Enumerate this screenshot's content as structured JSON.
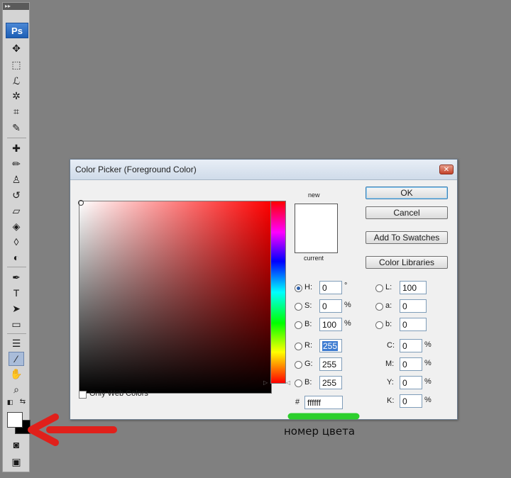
{
  "toolbar": {
    "logo": "Ps",
    "tools": [
      "move-tool",
      "marquee-tool",
      "lasso-tool",
      "magic-wand-tool",
      "crop-tool",
      "eyedropper-tool",
      "healing-brush-tool",
      "brush-tool",
      "clone-stamp-tool",
      "history-brush-tool",
      "eraser-tool",
      "paint-bucket-tool",
      "blur-tool",
      "dodge-tool",
      "pen-tool",
      "type-tool",
      "path-selection-tool",
      "shape-tool",
      "notes-tool",
      "eyedropper-active-tool",
      "hand-tool",
      "zoom-tool"
    ],
    "foreground_color": "#ffffff",
    "background_color": "#000000"
  },
  "dialog": {
    "title": "Color Picker (Foreground Color)",
    "only_web_colors_label": "Only Web Colors",
    "new_label": "new",
    "current_label": "current",
    "buttons": {
      "ok": "OK",
      "cancel": "Cancel",
      "add_to_swatches": "Add To Swatches",
      "color_libraries": "Color Libraries"
    },
    "hsb": {
      "h_label": "H:",
      "h_value": "0",
      "h_unit": "°",
      "s_label": "S:",
      "s_value": "0",
      "s_unit": "%",
      "b_label": "B:",
      "b_value": "100",
      "b_unit": "%"
    },
    "rgb": {
      "r_label": "R:",
      "r_value": "255",
      "g_label": "G:",
      "g_value": "255",
      "b_label": "B:",
      "b_value": "255"
    },
    "lab": {
      "l_label": "L:",
      "l_value": "100",
      "a_label": "a:",
      "a_value": "0",
      "b_label": "b:",
      "b_value": "0"
    },
    "cmyk": {
      "c_label": "C:",
      "c_value": "0",
      "m_label": "M:",
      "m_value": "0",
      "y_label": "Y:",
      "y_value": "0",
      "k_label": "K:",
      "k_value": "0",
      "unit": "%"
    },
    "hex": {
      "label": "#",
      "value": "ffffff"
    },
    "selected_color": "#ffffff"
  },
  "annotation": {
    "caption": "номер цвета",
    "arrow_color": "#e0201b",
    "highlight_color": "#2ccf2c"
  }
}
